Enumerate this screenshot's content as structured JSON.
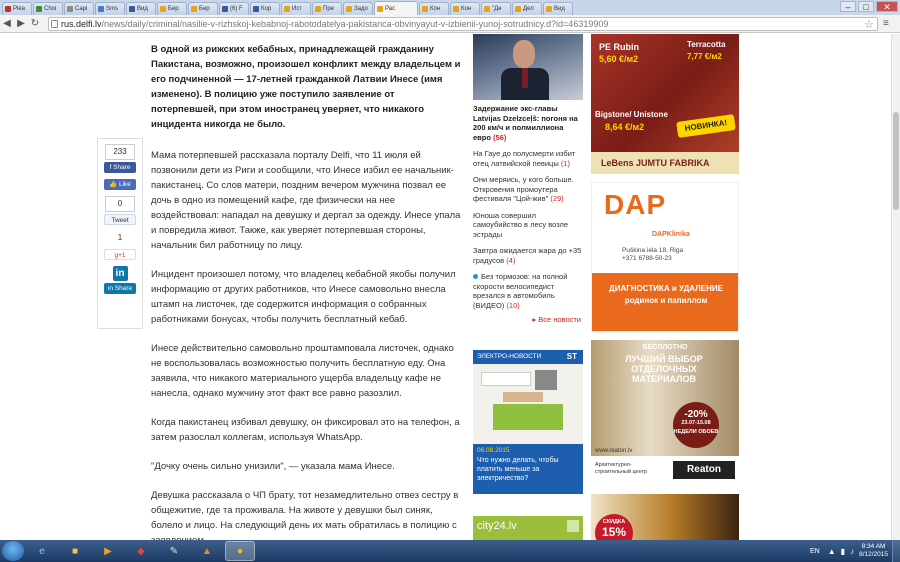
{
  "browser": {
    "tabs": [
      {
        "label": "Plea",
        "color": "#cc2b2b",
        "active": false
      },
      {
        "label": "Choi",
        "color": "#3b8d3b",
        "active": false
      },
      {
        "label": "Capi",
        "color": "#8c8c8c",
        "active": false
      },
      {
        "label": "Sms",
        "color": "#4a79c5",
        "active": false
      },
      {
        "label": "Вид",
        "color": "#3b5998",
        "active": false
      },
      {
        "label": "Бер",
        "color": "#e8a21c",
        "active": false
      },
      {
        "label": "Бер",
        "color": "#e8a21c",
        "active": false
      },
      {
        "label": "(6) F",
        "color": "#3b5998",
        "active": false
      },
      {
        "label": "Кор",
        "color": "#3b5998",
        "active": false
      },
      {
        "label": "Ист",
        "color": "#e8a21c",
        "active": false
      },
      {
        "label": "Пре",
        "color": "#e8a21c",
        "active": false
      },
      {
        "label": "Задо",
        "color": "#e8a21c",
        "active": false
      },
      {
        "label": "Рас",
        "color": "#e8a21c",
        "active": true
      },
      {
        "label": "Кон",
        "color": "#e8a21c",
        "active": false
      },
      {
        "label": "Кон",
        "color": "#e8a21c",
        "active": false
      },
      {
        "label": "\"Де",
        "color": "#e8a21c",
        "active": false
      },
      {
        "label": "Дел",
        "color": "#e8a21c",
        "active": false
      },
      {
        "label": "Вид",
        "color": "#e8a21c",
        "active": false
      }
    ],
    "url_host": "rus.delfi.lv",
    "url_path": "/news/daily/criminal/nasilie-v-rizhskoj-kebabnoj-rabotodatelya-pakistanca-obvinyayut-v-izbienii-yunoj-sotrudnicy.d?id=46319909"
  },
  "share": {
    "fb_count": "233",
    "fb_share": "Share",
    "fb_like": "Like",
    "tw_count": "0",
    "tw_label": "Tweet",
    "gp_count": "1",
    "gp_label": "g+1",
    "in_logo": "in",
    "in_label": "Share"
  },
  "article": {
    "lead": "В одной из рижских кебабных, принадлежащей гражданину Пакистана, возможно, произошел конфликт между владельцем и его подчиненной — 17-летней гражданкой Латвии Инесе (имя изменено). В полицию уже поступило заявление от потерпевшей, при этом иностранец уверяет, что никакого инцидента никогда не было.",
    "paragraphs": [
      "Мама потерпевшей рассказала порталу Delfi, что 11 июля ей позвонили дети из Риги и сообщили, что Инесе избил ее начальник-пакистанец. Со слов матери, поздним вечером мужчина позвал ее дочь в одно из помещений кафе, где физически на нее воздействовал: нападал на девушку и дергал за одежду. Инесе упала и повредила живот. Также, как уверяет потерпевшая стороны, начальник бил работницу по лицу.",
      "Инцидент произошел потому, что владелец кебабной якобы получил информацию от других работников, что Инесе самовольно внесла штамп на листочек, где содержится информация о собранных работниками бонусах, чтобы получить бесплатный кебаб.",
      "Инесе действительно самовольно проштамповала листочек, однако не воспользовалась возможностью получить бесплатную еду. Она заявила, что никакого материального ущерба владельцу кафе не нанесла, однако мужчину этот факт все равно разозлил.",
      "Когда пакистанец избивал девушку, он фиксировал это на телефон, а затем разослал коллегам, используя WhatsApp.",
      "\"Дочку очень сильно унизили\", — указала мама Инесе.",
      "Девушка рассказала о ЧП брату, тот незамедлительно отвез сестру в общежитие, где та проживала. На животе у девушки был синяк, болело и лицо. На следующий день их мать обратилась в полицию с заявлением."
    ]
  },
  "rail": {
    "headline": "Задержание экс-главы Latvijas Dzelzceļš: погоня на 200 км/ч и полмиллиона евро",
    "headline_count": "(56)",
    "items": [
      {
        "text": "На Гауе до полусмерти избит отец латвийской певицы",
        "count": "(1)"
      },
      {
        "text": "Они меряись, у кого больше. Откровения промоутера фестиваля \"Цой-жив\"",
        "count": "(29)"
      },
      {
        "text": "Юноша совершил самоубийство в лесу возле эстрады",
        "count": ""
      },
      {
        "text": "Завтра ожидается жара до +35 градусов",
        "count": "(4)"
      },
      {
        "text": "Без тормозов: на полной скорости велосипедист врезался в автомобиль (ВИДЕО)",
        "count": "(10)"
      }
    ],
    "all_news": "Все новости",
    "elektro_title": "ЭЛЕКТРО-НОВОСТИ",
    "elektro_brand": "ST",
    "elektro_date": "06.08.2015",
    "elektro_text": "Что нужно делать, чтобы платить меньше за электричество?",
    "city24": "city24.lv"
  },
  "ads": {
    "lebens": {
      "t1": "PE Rubin",
      "p1": "5,60 €/м2",
      "t2": "Terracotta",
      "p2": "7,77 €/м2",
      "t3": "Bigstone/ Unistone",
      "p3": "8,64 €/м2",
      "badge": "НОВИНКА!",
      "brand": "LeBens JUMTU FABRIKA"
    },
    "dap": {
      "logo": "DAP",
      "sub": "DAPKlinika",
      "addr": "Puškina iela 18, Riga",
      "tel": "+371 6788-50-23",
      "band": "ДИАГНОСТИКА и УДАЛЕНИЕ родинок и папиллом"
    },
    "reaton": {
      "h1": "БЕСПЛОТНО",
      "h2": "ЛУЧШИЙ ВЫБОР ОТДЕЛОЧНЫХ МАТЕРИАЛОВ",
      "disc": "-20%",
      "disc_sub": "23.07-15.08 НЕДЕЛИ ОБОЕВ",
      "web": "www.reaton.lv",
      "cat": "Архитектурно-строительный центр",
      "logo": "Reaton"
    },
    "promo": {
      "badge_top": "СКИДКА",
      "badge_val": "15%"
    }
  },
  "taskbar": {
    "lang": "EN",
    "time": "8:34 AM",
    "date": "8/12/2015"
  }
}
